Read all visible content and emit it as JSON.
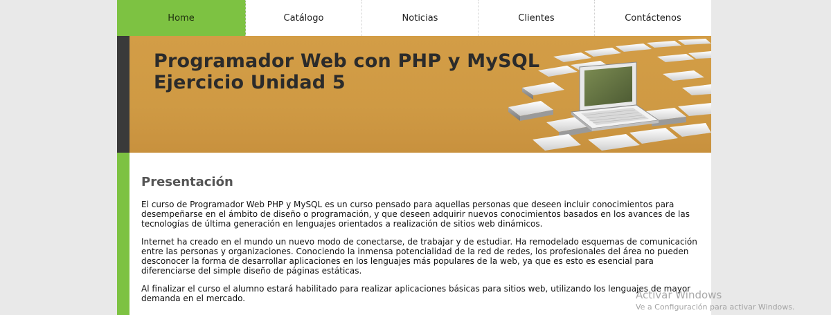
{
  "nav": {
    "items": [
      {
        "label": "Home",
        "active": true
      },
      {
        "label": "Catálogo",
        "active": false
      },
      {
        "label": "Noticias",
        "active": false
      },
      {
        "label": "Clientes",
        "active": false
      },
      {
        "label": "Contáctenos",
        "active": false
      }
    ]
  },
  "banner": {
    "title_line1": "Programador Web con PHP y MySQL",
    "title_line2": "Ejercicio Unidad 5",
    "image": "laptop-on-tiles-icon"
  },
  "content": {
    "heading": "Presentación",
    "paragraphs": [
      "El curso de Programador Web PHP y MySQL es un curso pensado para aquellas personas que deseen incluir conocimientos para desempeñarse en el ámbito de diseño o programación, y que deseen adquirir nuevos conocimientos basados en los avances de las tecnologías de última generación en lenguajes orientados a realización de sitios web dinámicos.",
      "Internet ha creado en el mundo un nuevo modo de conectarse, de trabajar y de estudiar. Ha remodelado esquemas de comunicación entre las personas y organizaciones. Conociendo la inmensa potencialidad de la red de redes, los profesionales del área no pueden desconocer la forma de desarrollar aplicaciones en los lenguajes más populares de la web, ya que es esto es esencial para diferenciarse del simple diseño de páginas estáticas.",
      "Al finalizar el curso el alumno estará habilitado para realizar aplicaciones básicas para sitios web, utilizando los lenguajes de mayor demanda en el mercado."
    ]
  },
  "watermark": {
    "title": "Activar Windows",
    "subtitle": "Ve a Configuración para activar Windows."
  },
  "colors": {
    "accent_green": "#7dc242",
    "banner_orange": "#d39d46",
    "dark_bar": "#3a3a3a"
  }
}
